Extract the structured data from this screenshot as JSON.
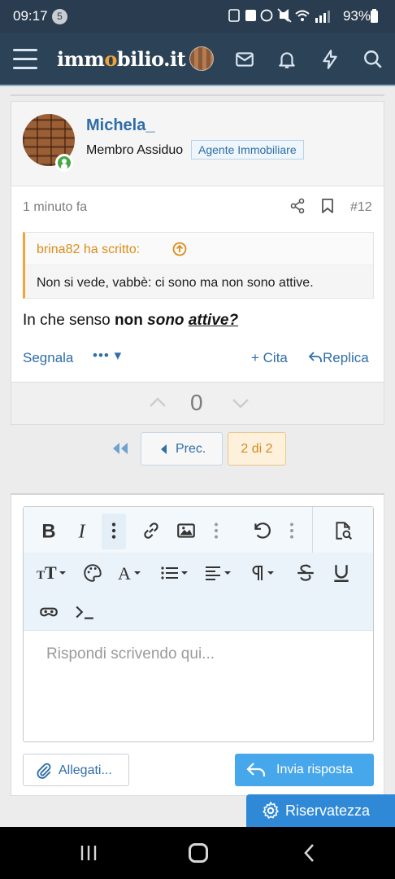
{
  "status_bar": {
    "time": "09:17",
    "notification_count": "5",
    "battery": "93%"
  },
  "header": {
    "logo_prefix": "imm",
    "logo_accent": "o",
    "logo_suffix": "bilio.it",
    "icons": [
      "menu-icon",
      "avatar",
      "mail-icon",
      "bell-icon",
      "lightning-icon",
      "search-icon"
    ]
  },
  "post": {
    "username": "Michela_",
    "user_title": "Membro Assiduo",
    "user_badge": "Agente Immobiliare",
    "time": "1 minuto fa",
    "post_number": "#12",
    "quote": {
      "author": "brina82 ha scritto:",
      "text": "Non si vede, vabbè: ci sono ma non sono attive."
    },
    "message": {
      "part1": "In che senso ",
      "part2": "non",
      "part3": " ",
      "part4": "sono",
      "part5": " ",
      "part6": "attive?"
    },
    "actions": {
      "report": "Segnala",
      "more": "••• ▾",
      "cite": "+ Cita",
      "reply": "Replica"
    },
    "score": "0"
  },
  "pagination": {
    "prev_label": "Prec.",
    "current_page": "2 di 2"
  },
  "editor": {
    "placeholder": "Rispondi scrivendo qui...",
    "attach_label": "Allegati...",
    "send_label": "Invia risposta"
  },
  "privacy_label": "Riservatezza",
  "colors": {
    "header_bg": "#2c4257",
    "link_blue": "#2f6ea8",
    "accent_orange": "#f0a637",
    "send_button": "#47a7eb",
    "privacy_button": "#2f89d6"
  }
}
